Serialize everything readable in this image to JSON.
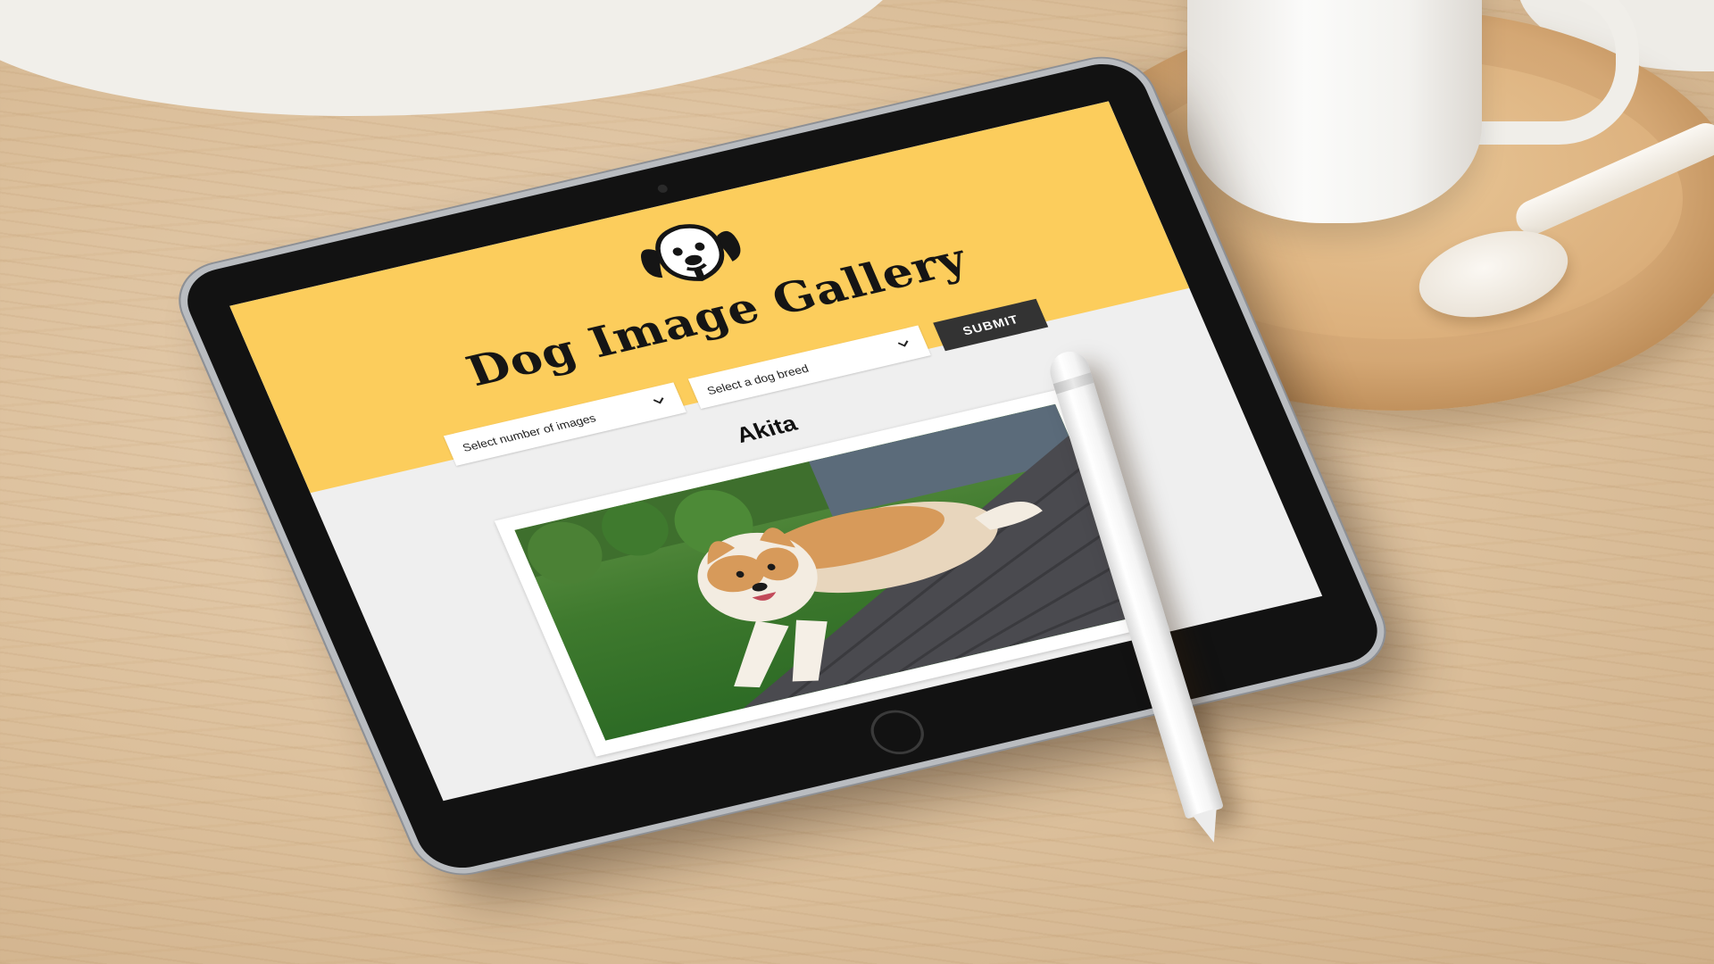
{
  "site": {
    "title": "Dog Image Gallery",
    "logo_icon": "dog-face-icon"
  },
  "controls": {
    "count_select": {
      "placeholder": "Select number of images"
    },
    "breed_select": {
      "placeholder": "Select a dog breed"
    },
    "submit_label": "SUBMIT"
  },
  "gallery": {
    "breed_heading": "Akita",
    "image_alt": "Akita"
  },
  "colors": {
    "hero_yellow": "#fccd5c",
    "submit_bg": "#333333",
    "page_bg": "#efefef"
  }
}
